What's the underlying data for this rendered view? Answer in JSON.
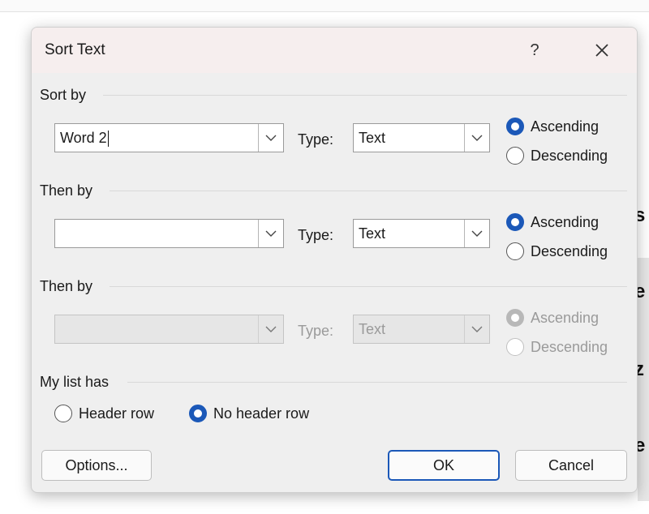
{
  "background": {
    "right_glyphs": [
      "s",
      "e",
      "z",
      "e"
    ]
  },
  "dialog": {
    "title": "Sort Text",
    "help_label": "?",
    "close_icon": "close-icon"
  },
  "sort_by": {
    "label": "Sort by",
    "field_value": "Word 2",
    "type_label": "Type:",
    "type_value": "Text",
    "ascending_label": "Ascending",
    "descending_label": "Descending",
    "selected": "Ascending"
  },
  "then_by_1": {
    "label": "Then by",
    "field_value": "",
    "type_label": "Type:",
    "type_value": "Text",
    "ascending_label": "Ascending",
    "descending_label": "Descending",
    "selected": "Ascending"
  },
  "then_by_2": {
    "label": "Then by",
    "field_value": "",
    "type_label": "Type:",
    "type_value": "Text",
    "ascending_label": "Ascending",
    "descending_label": "Descending",
    "selected": "Ascending",
    "enabled": false
  },
  "list_has": {
    "label": "My list has",
    "header_row_label": "Header row",
    "no_header_row_label": "No header row",
    "selected": "No header row"
  },
  "buttons": {
    "options_label": "Options...",
    "ok_label": "OK",
    "cancel_label": "Cancel"
  },
  "colors": {
    "accent": "#1b58b8",
    "title_bar": "#f6eeee",
    "dialog_bg": "#efefef"
  }
}
